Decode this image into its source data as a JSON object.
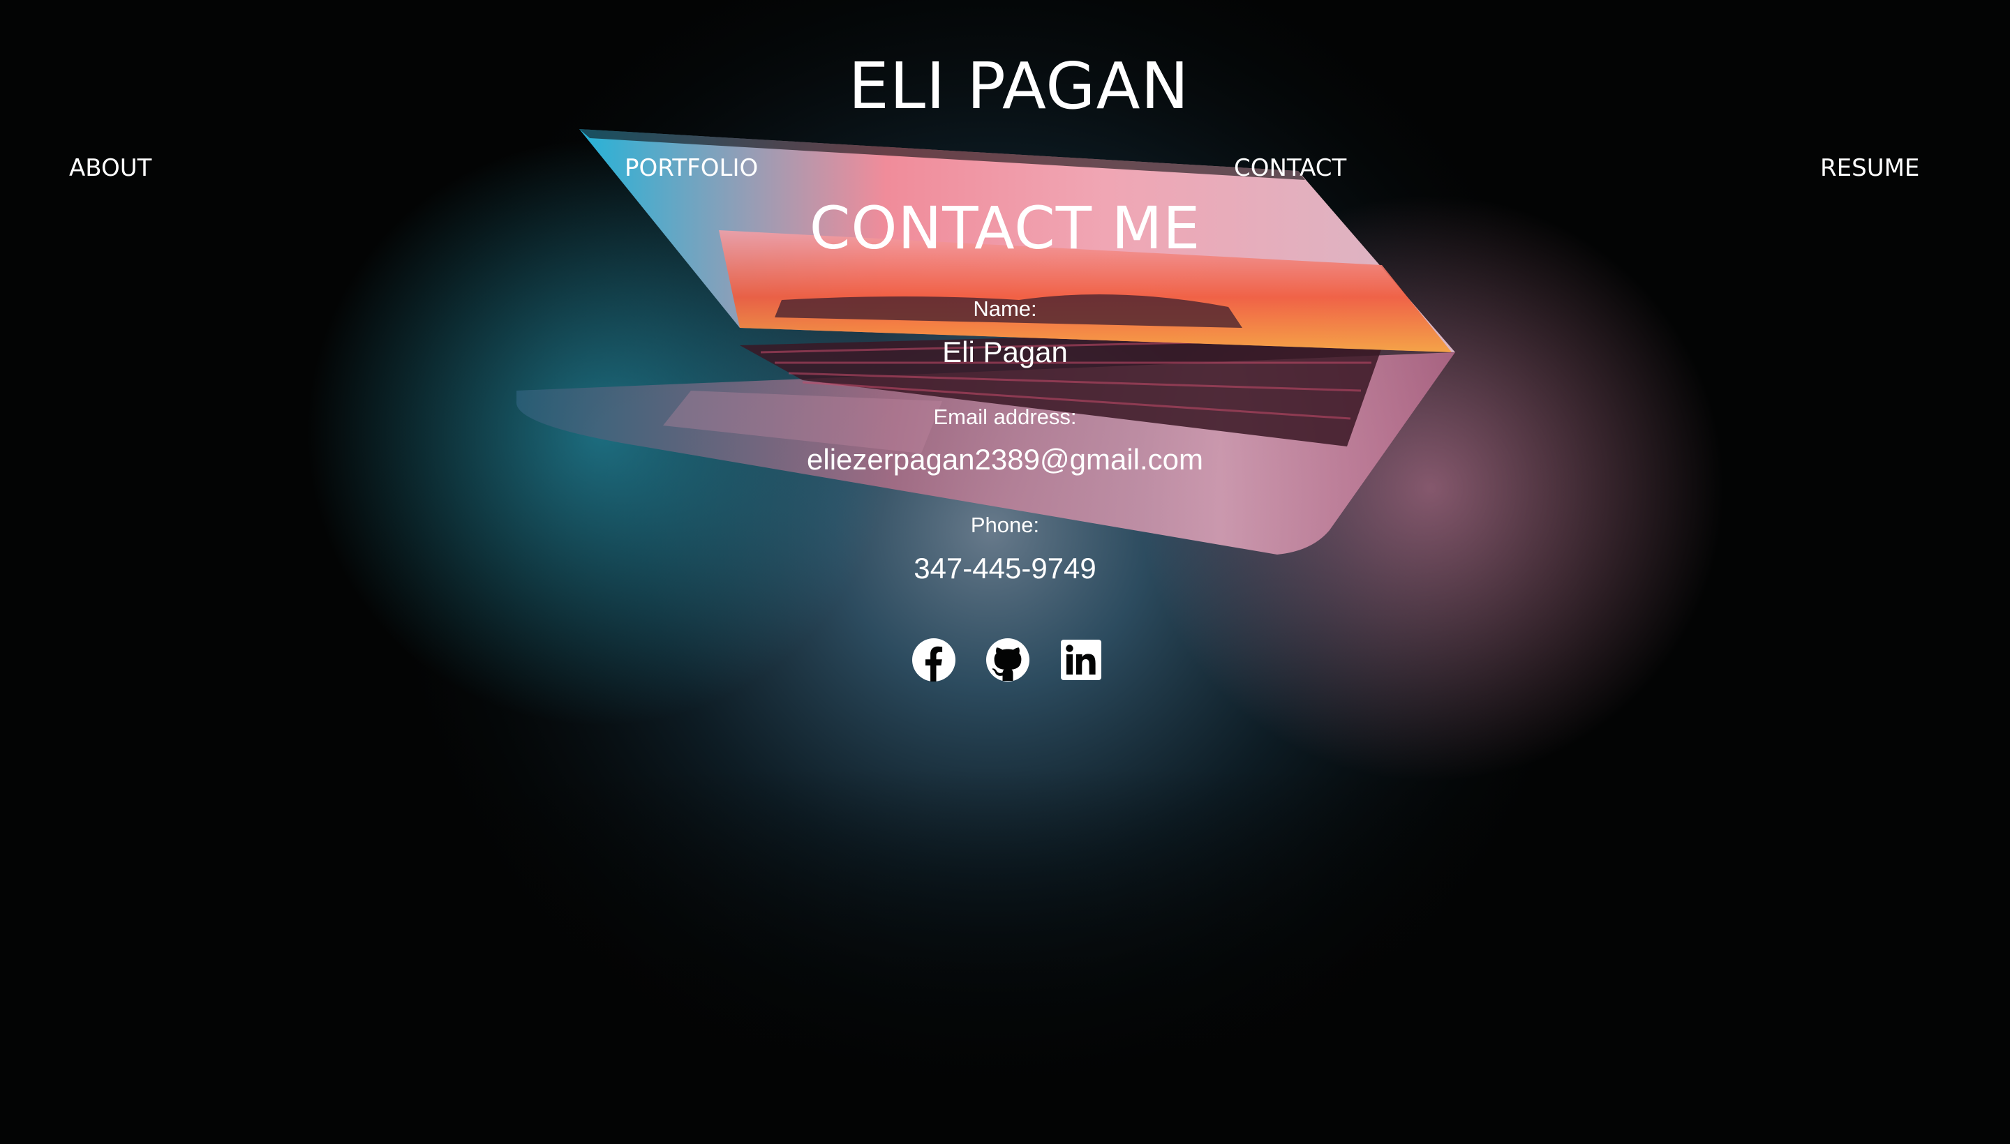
{
  "site": {
    "title": "ELI PAGAN"
  },
  "nav": {
    "items": [
      {
        "label": "ABOUT"
      },
      {
        "label": "PORTFOLIO"
      },
      {
        "label": "CONTACT"
      },
      {
        "label": "RESUME"
      }
    ]
  },
  "contact": {
    "heading": "CONTACT ME",
    "name_label": "Name:",
    "name_value": "Eli Pagan",
    "email_label": "Email address:",
    "email_value": "eliezerpagan2389@gmail.com",
    "phone_label": "Phone:",
    "phone_value": "347-445-9749",
    "social": [
      {
        "icon": "facebook-icon"
      },
      {
        "icon": "github-icon"
      },
      {
        "icon": "linkedin-icon"
      }
    ]
  },
  "background": {
    "image": "laptop-photo",
    "colors": {
      "base": "#020303",
      "screen_cyan": "#2fb6d6",
      "screen_orange": "#f2643a",
      "screen_pink": "#e6a3b8",
      "surface_blue": "#3a6b86"
    }
  }
}
